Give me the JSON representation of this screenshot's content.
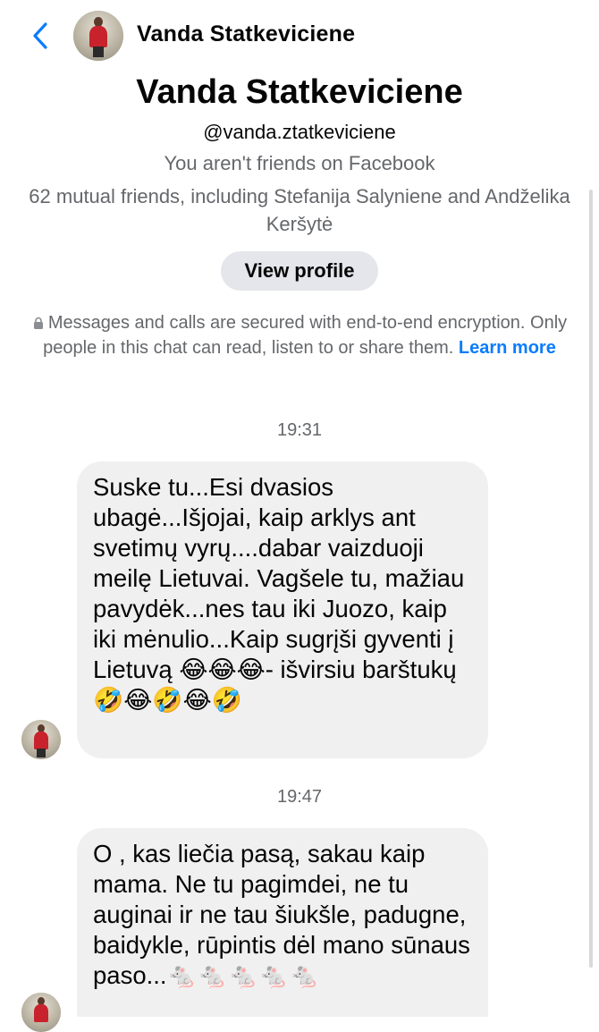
{
  "header": {
    "title": "Vanda Statkeviciene",
    "back_icon": "chevron-left-icon",
    "accent_color": "#0a7cff"
  },
  "profile": {
    "name": "Vanda Statkeviciene",
    "handle": "@vanda.ztatkeviciene",
    "friend_status": "You aren't friends on Facebook",
    "mutual_friends": "62 mutual friends, including Stefanija Salyniene and Andželika Keršytė",
    "view_profile_label": "View profile"
  },
  "encryption": {
    "icon": "lock-icon",
    "text": "Messages and calls are secured with end-to-end encryption. Only people in this chat can read, listen to or share them.",
    "link_label": "Learn more"
  },
  "messages": [
    {
      "time": "19:31",
      "text": "Suske tu...Esi dvasios ubagė...Išjojai, kaip arklys ant svetimų vyrų....dabar vaizduoji meilę Lietuvai. Vagšele tu, mažiau pavydėk...nes tau iki Juozo, kaip iki mėnulio...Kaip sugrįši gyventi į Lietuvą 😂😂😂- išvirsiu barštukų🤣😂🤣😂🤣"
    },
    {
      "time": "19:47",
      "text": "O , kas liečia pasą, sakau kaip mama. Ne tu pagimdei, ne tu auginai ir ne tau šiukšle, padugne, baidykle, rūpintis dėl mano sūnaus paso...🐁🐁🐁🐁🐁"
    }
  ]
}
